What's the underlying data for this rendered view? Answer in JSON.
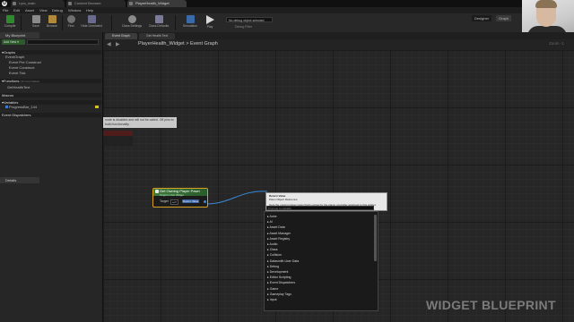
{
  "doc_tabs": [
    "Lyra_main",
    "Content Browser",
    "PlayerHealth_Widget"
  ],
  "menu": [
    "File",
    "Edit",
    "Asset",
    "View",
    "Debug",
    "Window",
    "Help"
  ],
  "toolbar": {
    "buttons": [
      "Compile",
      "Save",
      "Browse",
      "Find",
      "Hide Unrelated",
      "Class Settings",
      "Class Defaults",
      "Simulation",
      "Play"
    ],
    "debug_select": "No debug object selected",
    "debug_label": "Debug Filter"
  },
  "modes": [
    "Designer",
    "Graph"
  ],
  "left": {
    "tab": "My Blueprint",
    "add_new": "Add New",
    "sections": [
      {
        "head": "Graphs",
        "items": [
          "EventGraph",
          "Event Pre Construct",
          "Event Construct",
          "Event Tick"
        ]
      },
      {
        "head": "Functions",
        "suffix": "(18 Overridable)",
        "items": [
          "GetHealthText"
        ]
      },
      {
        "head": "Macros",
        "items": []
      },
      {
        "head": "Variables",
        "items": [
          "ProgressBar_144"
        ]
      },
      {
        "head": "Event Dispatchers",
        "items": []
      }
    ],
    "details_tab": "Details"
  },
  "graph_tabs": [
    "Event Graph",
    "Get Health Text"
  ],
  "breadcrumb": {
    "root": "PlayerHealth_Widget",
    "sep": ">",
    "leaf": "Event Graph"
  },
  "zoom": "Zoom -1",
  "disabled_tip": "node is disabled and will not be called. Off pins to build functionality.",
  "node": {
    "title": "Get Owning Player Pawn",
    "subtitle": "Target is User Widget",
    "target_label": "Target",
    "self_label": "self",
    "return_label": "Return Value"
  },
  "context_menu": {
    "tooltip_title": "Return Value",
    "tooltip_type": "Pawn Object Reference",
    "tooltip_desc": "Gets the owning player pawn that's owned by the player controller assigned to this widget.",
    "search_placeholder": "Promote to variable",
    "items": [
      "Actor",
      "AI",
      "Asset Data",
      "Asset Manager",
      "Asset Registry",
      "Audio",
      "Class",
      "Collision",
      "Datasmith User Data",
      "Debug",
      "Development",
      "Editor Scripting",
      "Event Dispatchers",
      "Game",
      "Gameplay Tags",
      "Input"
    ]
  },
  "watermark": "WIDGET BLUEPRINT"
}
